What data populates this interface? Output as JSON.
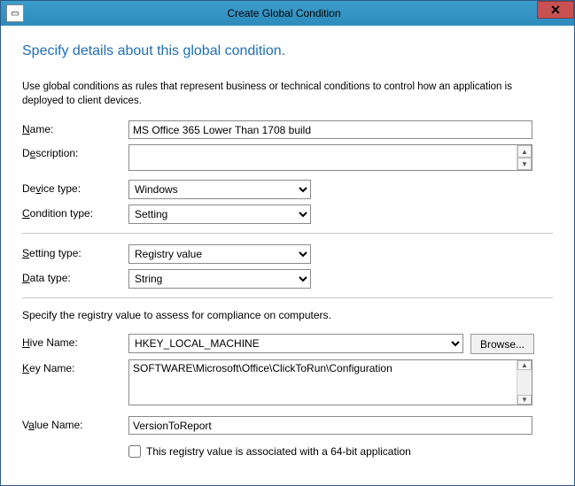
{
  "window": {
    "title": "Create Global Condition"
  },
  "heading": "Specify details about this global condition.",
  "intro": "Use global conditions as rules that represent business or technical conditions to control how an application is deployed to client devices.",
  "labels": {
    "name": "Name:",
    "description": "Description:",
    "deviceType": "Device type:",
    "conditionType": "Condition type:",
    "settingType": "Setting type:",
    "dataType": "Data type:",
    "hiveName": "Hive Name:",
    "keyName": "Key Name:",
    "valueName": "Value Name:"
  },
  "values": {
    "name": "MS Office 365 Lower Than 1708 build",
    "description": "",
    "deviceType": "Windows",
    "conditionType": "Setting",
    "settingType": "Registry value",
    "dataType": "String",
    "hiveName": "HKEY_LOCAL_MACHINE",
    "keyName": "SOFTWARE\\Microsoft\\Office\\ClickToRun\\Configuration",
    "valueName": "VersionToReport"
  },
  "registryIntro": "Specify the registry value to assess for compliance on computers.",
  "browse": "Browse...",
  "checkboxLabel": "This registry value is associated with a 64-bit application",
  "checkboxChecked": false
}
